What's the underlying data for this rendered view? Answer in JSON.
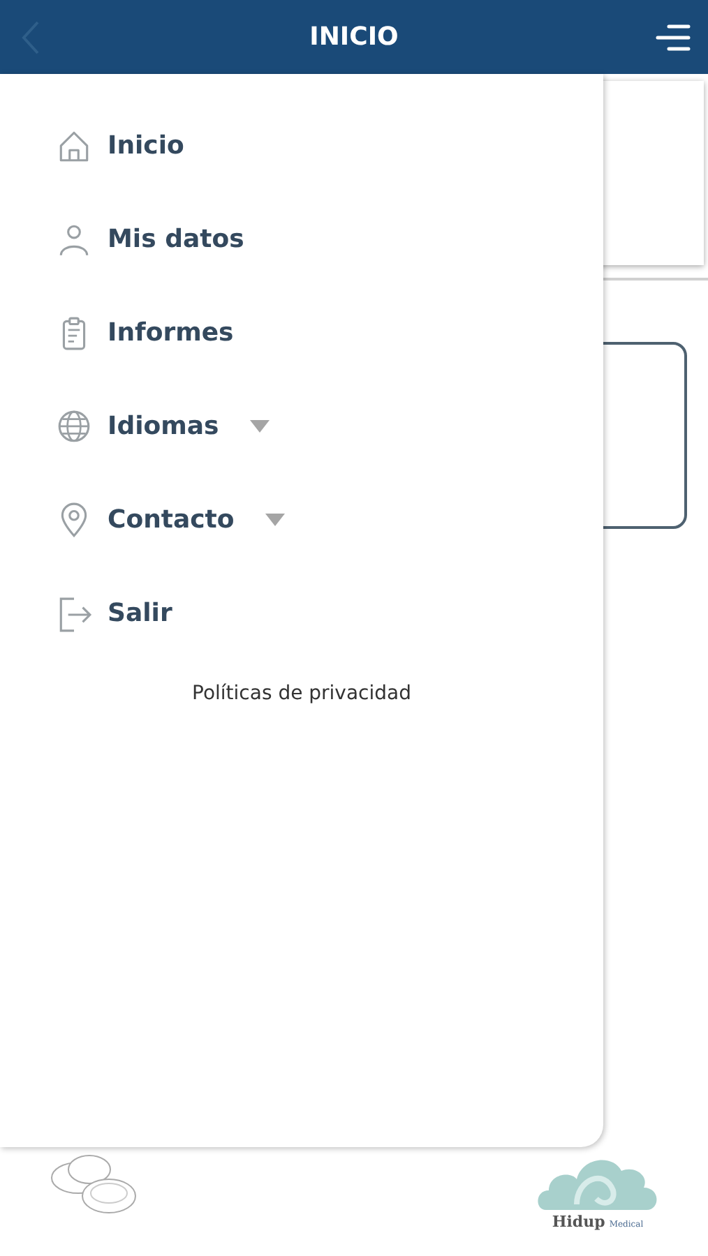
{
  "header": {
    "title": "INICIO"
  },
  "menu": {
    "items": [
      {
        "label": "Inicio",
        "has_submenu": false
      },
      {
        "label": "Mis datos",
        "has_submenu": false
      },
      {
        "label": "Informes",
        "has_submenu": false
      },
      {
        "label": "Idiomas",
        "has_submenu": true
      },
      {
        "label": "Contacto",
        "has_submenu": true
      },
      {
        "label": "Salir",
        "has_submenu": false
      }
    ],
    "privacy_link": "Políticas de privacidad"
  },
  "footer": {
    "brand": "Hidup",
    "brand_suffix": "Medical"
  }
}
